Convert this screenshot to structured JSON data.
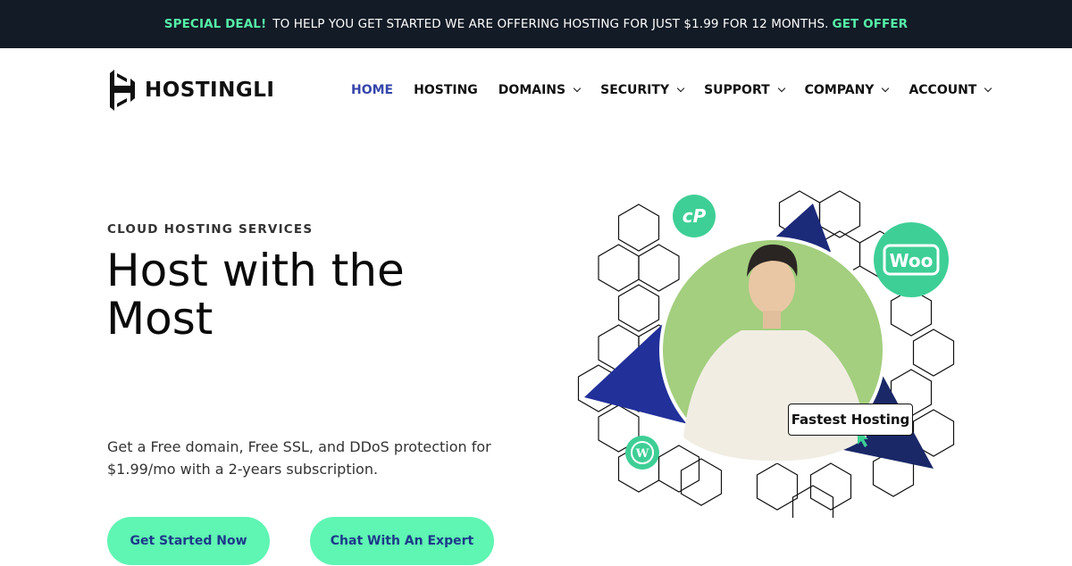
{
  "topbar": {
    "deal_label": "SPECIAL DEAL!",
    "message": "TO HELP YOU GET STARTED WE ARE OFFERING HOSTING FOR JUST $1.99 FOR 12 MONTHS.",
    "offer_link": "GET OFFER"
  },
  "logo": {
    "text": "HOSTINGLI",
    "icon": "hostingli-h-logo-icon"
  },
  "nav": {
    "items": [
      {
        "label": "HOME",
        "active": true,
        "dropdown": false
      },
      {
        "label": "HOSTING",
        "active": false,
        "dropdown": false
      },
      {
        "label": "DOMAINS",
        "active": false,
        "dropdown": true
      },
      {
        "label": "SECURITY",
        "active": false,
        "dropdown": true
      },
      {
        "label": "SUPPORT",
        "active": false,
        "dropdown": true
      },
      {
        "label": "COMPANY",
        "active": false,
        "dropdown": true
      },
      {
        "label": "ACCOUNT",
        "active": false,
        "dropdown": true
      }
    ]
  },
  "hero": {
    "eyebrow": "CLOUD HOSTING SERVICES",
    "title": "Host with the Most",
    "description": "Get a Free domain, Free SSL, and DDoS protection for $1.99/mo with a 2-years subscription.",
    "primary_button": "Get Started Now",
    "secondary_button": "Chat With An Expert"
  },
  "illustration": {
    "badge_text": "Fastest Hosting",
    "icons": [
      "cpanel-icon",
      "woocommerce-icon",
      "wordpress-icon",
      "cursor-icon"
    ],
    "woo_text": "Woo",
    "cpanel_text": "cP"
  },
  "colors": {
    "topbar_bg": "#131b26",
    "accent_green": "#56f0a9",
    "button_green": "#5ff5b3",
    "nav_active": "#3746ab",
    "triangle_blue": "#1c2a7a",
    "icon_green": "#3ecf96",
    "photo_bg": "#a3cf7f"
  }
}
